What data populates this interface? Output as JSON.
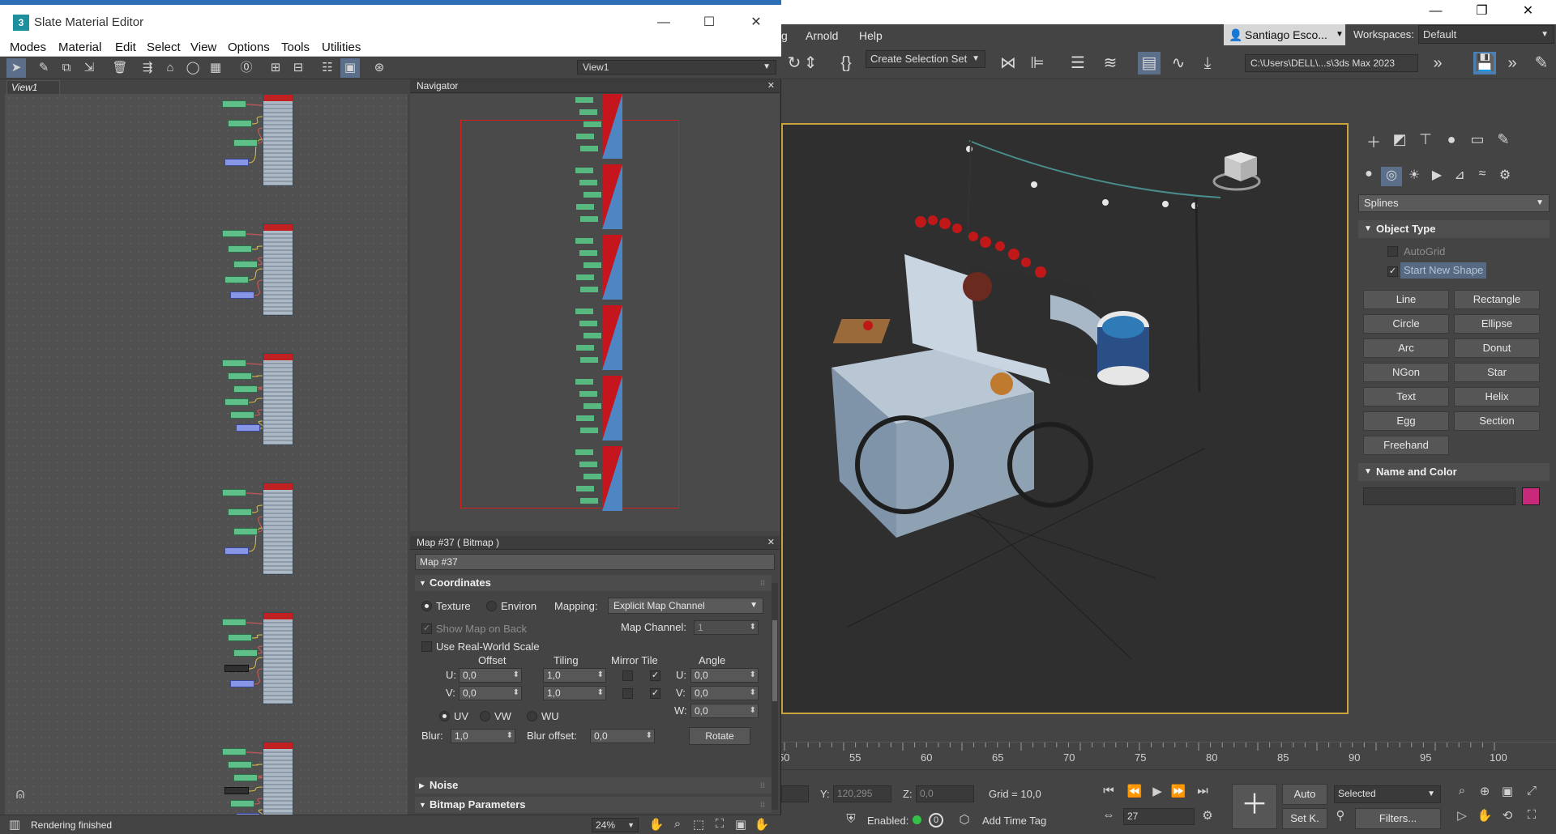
{
  "max": {
    "menus": [
      "g",
      "Arnold",
      "Help"
    ],
    "user": "Santiago Esco...",
    "workspace_label": "Workspaces:",
    "workspace_value": "Default",
    "selection_set": "Create Selection Set",
    "project_path": "C:\\Users\\DELL\\...s\\3ds Max 2023",
    "command_panel": {
      "category": "Splines",
      "object_type_title": "Object Type",
      "autogrid": "AutoGrid",
      "start_new_shape": "Start New Shape",
      "buttons": [
        "Line",
        "Rectangle",
        "Circle",
        "Ellipse",
        "Arc",
        "Donut",
        "NGon",
        "Star",
        "Text",
        "Helix",
        "Egg",
        "Section",
        "Freehand"
      ],
      "name_color_title": "Name and Color",
      "object_color": "#c8297a"
    },
    "timeline_ticks": [
      "50",
      "55",
      "60",
      "65",
      "70",
      "75",
      "80",
      "85",
      "90",
      "95",
      "100"
    ],
    "status": {
      "y_label": "Y:",
      "y_value": "120,295",
      "z_label": "Z:",
      "z_value": "0,0",
      "grid": "Grid = 10,0",
      "enabled": "Enabled:",
      "add_time_tag": "Add Time Tag",
      "frame": "27",
      "auto": "Auto",
      "set_key": "Set K.",
      "selected": "Selected",
      "filters": "Filters..."
    }
  },
  "sme": {
    "title": "Slate Material Editor",
    "menus": [
      "Modes",
      "Material",
      "Edit",
      "Select",
      "View",
      "Options",
      "Tools",
      "Utilities"
    ],
    "view_select": "View1",
    "view_tab": "View1",
    "navigator_title": "Navigator",
    "param_title": "Map #37  ( Bitmap )",
    "map_name": "Map #37",
    "coordinates": {
      "title": "Coordinates",
      "texture": "Texture",
      "environ": "Environ",
      "mapping_label": "Mapping:",
      "mapping_value": "Explicit Map Channel",
      "show_map_on_back": "Show Map on Back",
      "map_channel_label": "Map Channel:",
      "map_channel_value": "1",
      "use_real_world": "Use Real-World Scale",
      "offset": "Offset",
      "tiling": "Tiling",
      "mirror_tile": "Mirror Tile",
      "angle": "Angle",
      "u_label": "U:",
      "v_label": "V:",
      "w_label": "W:",
      "offset_u": "0,0",
      "offset_v": "0,0",
      "tiling_u": "1,0",
      "tiling_v": "1,0",
      "angle_u": "0,0",
      "angle_v": "0,0",
      "angle_w": "0,0",
      "uv": "UV",
      "vw": "VW",
      "wu": "WU",
      "blur_label": "Blur:",
      "blur_value": "1,0",
      "blur_offset_label": "Blur offset:",
      "blur_offset_value": "0,0",
      "rotate": "Rotate"
    },
    "noise_title": "Noise",
    "bitmap_params_title": "Bitmap Parameters",
    "status_text": "Rendering finished",
    "zoom": "24%"
  }
}
